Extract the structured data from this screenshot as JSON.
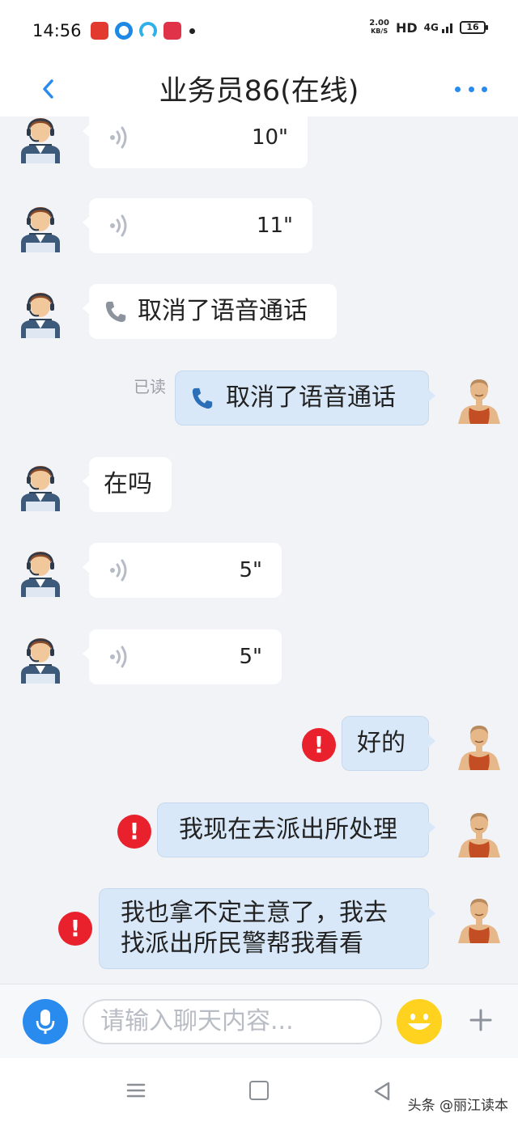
{
  "status_bar": {
    "time": "14:56",
    "net_speed": "2.00",
    "net_unit": "KB/S",
    "hd": "HD",
    "signal": "4G",
    "battery": "16"
  },
  "header": {
    "title": "业务员86(在线)",
    "back_icon": "chevron-left-icon",
    "more_icon": "more-dots-icon",
    "accent": "#2a8bef"
  },
  "messages": [
    {
      "side": "in",
      "type": "voice",
      "duration": "10\""
    },
    {
      "side": "in",
      "type": "voice",
      "duration": "11\""
    },
    {
      "side": "in",
      "type": "call",
      "text": "取消了语音通话"
    },
    {
      "side": "out",
      "type": "call",
      "text": "取消了语音通话",
      "read_label": "已读"
    },
    {
      "side": "in",
      "type": "text",
      "text": "在吗"
    },
    {
      "side": "in",
      "type": "voice",
      "duration": "5\""
    },
    {
      "side": "in",
      "type": "voice",
      "duration": "5\""
    },
    {
      "side": "out",
      "type": "text",
      "text": "好的",
      "failed": true
    },
    {
      "side": "out",
      "type": "text",
      "text": "我现在去派出所处理",
      "failed": true
    },
    {
      "side": "out",
      "type": "text",
      "text_line1": "我也拿不定主意了，我去",
      "text_line2": "找派出所民警帮我看看",
      "failed": true
    }
  ],
  "error_mark": "!",
  "input_bar": {
    "placeholder": "请输入聊天内容...",
    "mic_icon": "microphone-icon",
    "emoji_icon": "emoji-smile-icon",
    "plus_icon": "plus-icon"
  },
  "watermark": "头条 @丽江读本",
  "colors": {
    "incoming_bubble": "#ffffff",
    "outgoing_bubble": "#d9e8f8",
    "error": "#e8212c",
    "background": "#f1f3f7"
  }
}
